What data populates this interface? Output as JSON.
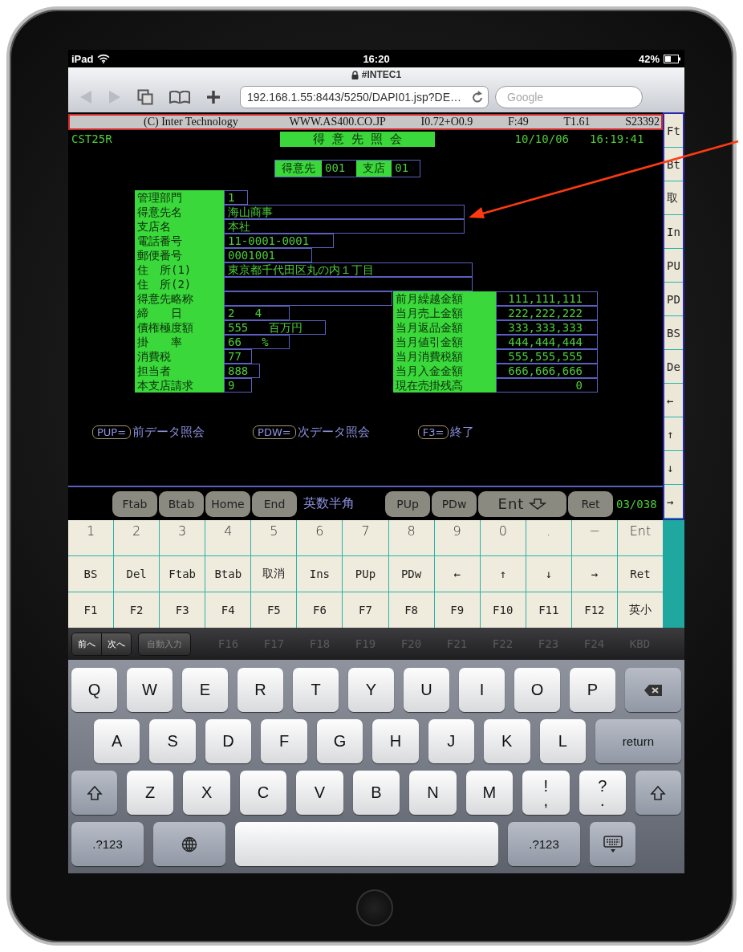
{
  "status_bar": {
    "device": "iPad",
    "time": "16:20",
    "battery": "42%"
  },
  "browser": {
    "title": "#INTEC1",
    "back_disabled": true,
    "forward_disabled": true,
    "url": "192.168.1.55:8443/5250/DAPI01.jsp?DE…",
    "search_placeholder": "Google"
  },
  "terminal": {
    "banner": [
      "(C) Inter Technology",
      "WWW.AS400.CO.JP",
      "I0.72+O0.9",
      "F:49",
      "T1.61",
      "S23392"
    ],
    "program": "CST25R",
    "title": "得 意 先 照 会",
    "date": "10/10/06",
    "time": "16:19:41",
    "key_fields": [
      {
        "label": "得意先",
        "value": "001"
      },
      {
        "label": "支店",
        "value": "01"
      }
    ],
    "fields": [
      {
        "label": "管理部門",
        "value": "1"
      },
      {
        "label": "得意先名",
        "value": "海山商事"
      },
      {
        "label": "支店名",
        "value": "本社"
      },
      {
        "label": "電話番号",
        "value": "11-0001-0001"
      },
      {
        "label": "郵便番号",
        "value": "0001001"
      },
      {
        "label": "住　所(1)",
        "value": "東京都千代田区丸の内１丁目"
      },
      {
        "label": "住　所(2)"
      },
      {
        "label": "得意先略称"
      },
      {
        "label": "締　　日",
        "value": "2   4"
      },
      {
        "label": "債権極度額",
        "value": "555   百万円"
      },
      {
        "label": "掛　　率",
        "value": "66   %"
      },
      {
        "label": "消費税",
        "value": "77"
      },
      {
        "label": "担当者",
        "value": "888"
      },
      {
        "label": "本支店請求",
        "value": "9"
      }
    ],
    "totals": [
      {
        "label": "前月繰越金額",
        "value": "111,111,111"
      },
      {
        "label": "当月売上金額",
        "value": "222,222,222"
      },
      {
        "label": "当月返品金額",
        "value": "333,333,333"
      },
      {
        "label": "当月値引金額",
        "value": "444,444,444"
      },
      {
        "label": "当月消費税額",
        "value": "555,555,555"
      },
      {
        "label": "当月入金金額",
        "value": "666,666,666"
      },
      {
        "label": "現在売掛残高",
        "value": "0"
      }
    ],
    "prompts": [
      {
        "key": "PUP=",
        "text": "前データ照会"
      },
      {
        "key": "PDW=",
        "text": "次データ照会"
      },
      {
        "key": "F3=",
        "text": "終了"
      }
    ]
  },
  "function_bar": [
    {
      "kind": "key",
      "label": "Ftab"
    },
    {
      "kind": "key",
      "label": "Btab"
    },
    {
      "kind": "key",
      "label": "Home"
    },
    {
      "kind": "key",
      "label": "End"
    },
    {
      "kind": "mode",
      "label": "英数半角"
    },
    {
      "kind": "key",
      "label": "PUp"
    },
    {
      "kind": "key",
      "label": "PDw"
    },
    {
      "kind": "enter",
      "label": "Ent"
    },
    {
      "kind": "key",
      "label": "Ret"
    },
    {
      "kind": "position",
      "label": "03/038"
    }
  ],
  "side_keys": [
    "Ft",
    "Bt",
    "取",
    "In",
    "PU",
    "PD",
    "BS",
    "De",
    "←",
    "↑",
    "↓",
    "→"
  ],
  "keypad": [
    [
      "1",
      "2",
      "3",
      "4",
      "5",
      "6",
      "7",
      "8",
      "9",
      "0",
      ".",
      "−",
      "Ent"
    ],
    [
      "BS",
      "Del",
      "Ftab",
      "Btab",
      "取消",
      "Ins",
      "PUp",
      "PDw",
      "←",
      "↑",
      "↓",
      "→",
      "Ret"
    ],
    [
      "F1",
      "F2",
      "F3",
      "F4",
      "F5",
      "F6",
      "F7",
      "F8",
      "F9",
      "F10",
      "F11",
      "F12",
      "英小"
    ]
  ],
  "form_assistant": {
    "buttons": [
      {
        "label": "前へ",
        "disabled": false
      },
      {
        "label": "次へ",
        "disabled": false
      },
      {
        "label": "自動入力",
        "disabled": true
      }
    ],
    "keypad_row": [
      "F16",
      "F17",
      "F18",
      "F19",
      "F20",
      "F21",
      "F22",
      "F23",
      "F24",
      "KBD"
    ]
  },
  "keyboard": [
    [
      {
        "kind": "letter",
        "label": "Q"
      },
      {
        "kind": "letter",
        "label": "W"
      },
      {
        "kind": "letter",
        "label": "E"
      },
      {
        "kind": "letter",
        "label": "R"
      },
      {
        "kind": "letter",
        "label": "T"
      },
      {
        "kind": "letter",
        "label": "Y"
      },
      {
        "kind": "letter",
        "label": "U"
      },
      {
        "kind": "letter",
        "label": "I"
      },
      {
        "kind": "letter",
        "label": "O"
      },
      {
        "kind": "letter",
        "label": "P"
      },
      {
        "kind": "backspace"
      }
    ],
    [
      {
        "kind": "letter",
        "label": "A"
      },
      {
        "kind": "letter",
        "label": "S"
      },
      {
        "kind": "letter",
        "label": "D"
      },
      {
        "kind": "letter",
        "label": "F"
      },
      {
        "kind": "letter",
        "label": "G"
      },
      {
        "kind": "letter",
        "label": "H"
      },
      {
        "kind": "letter",
        "label": "J"
      },
      {
        "kind": "letter",
        "label": "K"
      },
      {
        "kind": "letter",
        "label": "L"
      },
      {
        "kind": "return",
        "label": "return"
      }
    ],
    [
      {
        "kind": "shift"
      },
      {
        "kind": "letter",
        "label": "Z"
      },
      {
        "kind": "letter",
        "label": "X"
      },
      {
        "kind": "letter",
        "label": "C"
      },
      {
        "kind": "letter",
        "label": "V"
      },
      {
        "kind": "letter",
        "label": "B"
      },
      {
        "kind": "letter",
        "label": "N"
      },
      {
        "kind": "letter",
        "label": "M"
      },
      {
        "kind": "punct",
        "label": "!",
        "sub": ","
      },
      {
        "kind": "punct",
        "label": "?",
        "sub": "."
      },
      {
        "kind": "shift"
      }
    ],
    [
      {
        "kind": "numbers",
        "label": ".?123"
      },
      {
        "kind": "globe"
      },
      {
        "kind": "space"
      },
      {
        "kind": "numbers",
        "label": ".?123"
      },
      {
        "kind": "hide"
      }
    ]
  ]
}
